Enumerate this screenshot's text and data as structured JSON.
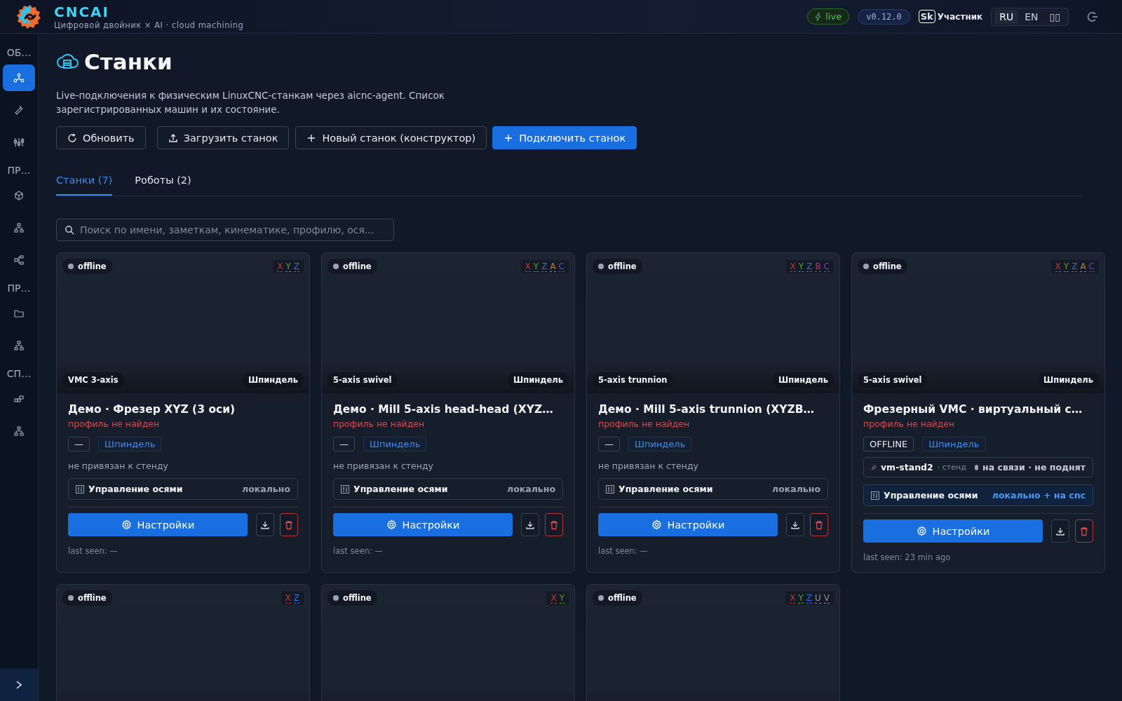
{
  "header": {
    "brand": "CNCAI",
    "subtitle": "Цифровой двойник × AI · cloud machining",
    "live": "live",
    "version": "v0.12.0",
    "partner_mark": "Sk",
    "partner": "Участник",
    "languages": [
      {
        "label": "RU",
        "selected": true
      },
      {
        "label": "EN",
        "selected": false
      },
      {
        "label": "▯▯",
        "selected": false
      }
    ]
  },
  "sidebar": {
    "items": [
      {
        "kind": "section",
        "label": "ОБ…"
      },
      {
        "kind": "icon",
        "selected": true
      },
      {
        "kind": "icon",
        "selected": false
      },
      {
        "kind": "icon",
        "selected": false
      },
      {
        "kind": "section",
        "label": "ПР…"
      },
      {
        "kind": "icon",
        "selected": false
      },
      {
        "kind": "icon",
        "selected": false
      },
      {
        "kind": "icon",
        "selected": false
      },
      {
        "kind": "section",
        "label": "ПР…"
      },
      {
        "kind": "icon",
        "selected": false
      },
      {
        "kind": "icon",
        "selected": false
      },
      {
        "kind": "section",
        "label": "СП…"
      },
      {
        "kind": "icon",
        "selected": false
      },
      {
        "kind": "icon",
        "selected": false
      }
    ]
  },
  "page": {
    "title": "Станки",
    "description": "Live-подключения к физическим LinuxCNC-станкам через aicnc-agent. Список зарегистрированных машин и их состояние.",
    "actions": [
      {
        "label": "Обновить",
        "primary": false
      },
      {
        "label": "Загрузить станок",
        "primary": false
      },
      {
        "label": "Новый станок (конструктор)",
        "primary": false
      },
      {
        "label": "Подключить станок",
        "primary": true
      }
    ],
    "tabs": [
      {
        "label": "Станки (7)",
        "selected": true
      },
      {
        "label": "Роботы (2)",
        "selected": false
      }
    ],
    "search": {
      "placeholder": "Поиск по имени, заметкам, кинематике, профилю, ося..."
    }
  },
  "machines": [
    {
      "status": "offline",
      "online": false,
      "axes": [
        {
          "label": "X",
          "color": "#c0392b"
        },
        {
          "label": "Y",
          "color": "#5a9e2f"
        },
        {
          "label": "Z",
          "color": "#2f6fd6"
        }
      ],
      "kinematics": "VMC 3-axis",
      "head": "Шпиндель",
      "title": "Демо · Фрезер XYZ (3 оси)",
      "profile": "профиль не найден",
      "tags": [
        {
          "label": "—",
          "kind": "plain"
        },
        {
          "label": "Шпиндель",
          "kind": "accent"
        }
      ],
      "binding": "не привязан к стенду",
      "axis_control": {
        "label": "Управление осями",
        "mode": "локально",
        "remote": false
      },
      "settings": "Настройки",
      "last_seen": "last seen: —"
    },
    {
      "status": "offline",
      "online": false,
      "axes": [
        {
          "label": "X",
          "color": "#c0392b"
        },
        {
          "label": "Y",
          "color": "#5a9e2f"
        },
        {
          "label": "Z",
          "color": "#2f6fd6"
        },
        {
          "label": "A",
          "color": "#c77a1e"
        },
        {
          "label": "C",
          "color": "#6a3fc0"
        }
      ],
      "kinematics": "5-axis swivel",
      "head": "Шпиндель",
      "title": "Демо · Mill 5-axis head-head (XYZ…",
      "profile": "профиль не найден",
      "tags": [
        {
          "label": "—",
          "kind": "plain"
        },
        {
          "label": "Шпиндель",
          "kind": "accent"
        }
      ],
      "binding": "не привязан к стенду",
      "axis_control": {
        "label": "Управление осями",
        "mode": "локально",
        "remote": false
      },
      "settings": "Настройки",
      "last_seen": "last seen: —"
    },
    {
      "status": "offline",
      "online": false,
      "axes": [
        {
          "label": "X",
          "color": "#c0392b"
        },
        {
          "label": "Y",
          "color": "#5a9e2f"
        },
        {
          "label": "Z",
          "color": "#2f6fd6"
        },
        {
          "label": "B",
          "color": "#b03a7a"
        },
        {
          "label": "C",
          "color": "#6a3fc0"
        }
      ],
      "kinematics": "5-axis trunnion",
      "head": "Шпиндель",
      "title": "Демо · Mill 5-axis trunnion (XYZB…",
      "profile": "профиль не найден",
      "tags": [
        {
          "label": "—",
          "kind": "plain"
        },
        {
          "label": "Шпиндель",
          "kind": "accent"
        }
      ],
      "binding": "не привязан к стенду",
      "axis_control": {
        "label": "Управление осями",
        "mode": "локально",
        "remote": false
      },
      "settings": "Настройки",
      "last_seen": "last seen: —"
    },
    {
      "status": "offline",
      "online": false,
      "axes": [
        {
          "label": "X",
          "color": "#c0392b"
        },
        {
          "label": "Y",
          "color": "#5a9e2f"
        },
        {
          "label": "Z",
          "color": "#2f6fd6"
        },
        {
          "label": "A",
          "color": "#c77a1e"
        },
        {
          "label": "C",
          "color": "#6a3fc0"
        }
      ],
      "kinematics": "5-axis swivel",
      "head": "Шпиндель",
      "title": "Фрезерный VMC · виртуальный с…",
      "profile": "профиль не найден",
      "tags": [
        {
          "label": "OFFLINE",
          "kind": "plain"
        },
        {
          "label": "Шпиндель",
          "kind": "accent"
        }
      ],
      "stand": {
        "name": "vm-stand2",
        "role": "· стенд",
        "state": "на связи · не поднят"
      },
      "axis_control": {
        "label": "Управление осями",
        "mode": "локально + на cnc",
        "remote": true
      },
      "settings": "Настройки",
      "last_seen": "last seen: 23 min ago"
    },
    {
      "status": "offline",
      "online": false,
      "axes": [
        {
          "label": "X",
          "color": "#c0392b"
        },
        {
          "label": "Z",
          "color": "#2f6fd6"
        }
      ]
    },
    {
      "status": "offline",
      "online": false,
      "axes": [
        {
          "label": "X",
          "color": "#c0392b"
        },
        {
          "label": "Y",
          "color": "#5a9e2f"
        }
      ]
    },
    {
      "status": "offline",
      "online": false,
      "axes": [
        {
          "label": "X",
          "color": "#c0392b"
        },
        {
          "label": "Y",
          "color": "#5a9e2f"
        },
        {
          "label": "Z",
          "color": "#2f6fd6"
        },
        {
          "label": "U",
          "color": "#8a94a6"
        },
        {
          "label": "V",
          "color": "#8a94a6"
        }
      ]
    }
  ]
}
